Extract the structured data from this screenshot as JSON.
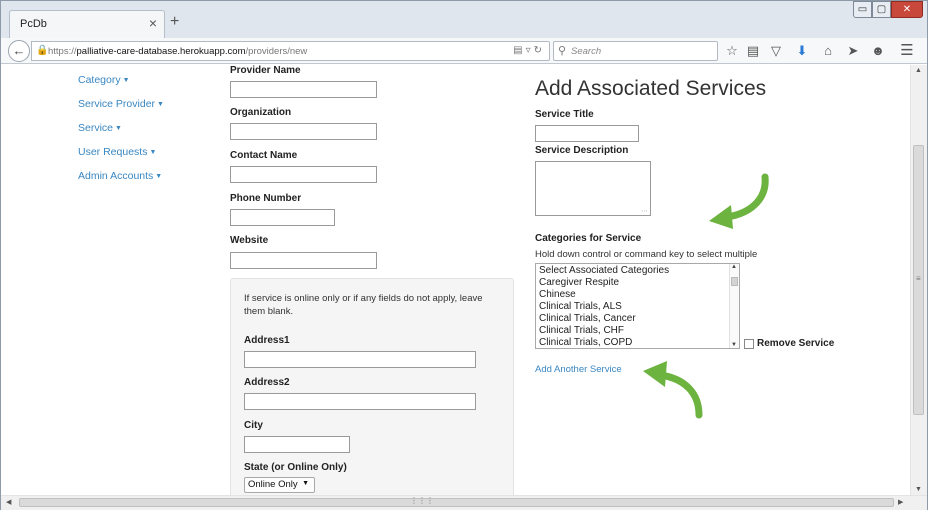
{
  "browser": {
    "tab_title": "PcDb",
    "tab_close": "×",
    "new_tab": "+",
    "url_prefix": "https://",
    "url_host": "palliative-care-database.herokuapp.com",
    "url_path": "/providers/new",
    "search_placeholder": "Search",
    "window_controls": {
      "minimize": "▭",
      "maximize": "▢",
      "close": "✕"
    },
    "toolbar_icons": [
      "star-icon",
      "reading-list-icon",
      "pocket-icon",
      "download-icon",
      "home-icon",
      "send-icon",
      "chat-icon",
      "menu-icon"
    ]
  },
  "sidebar": {
    "items": [
      {
        "label": "Category"
      },
      {
        "label": "Service Provider"
      },
      {
        "label": "Service"
      },
      {
        "label": "User Requests"
      },
      {
        "label": "Admin Accounts"
      }
    ]
  },
  "provider_form": {
    "provider_name_label": "Provider Name",
    "organization_label": "Organization",
    "contact_name_label": "Contact Name",
    "phone_number_label": "Phone Number",
    "website_label": "Website",
    "well_note": "If service is online only or if any fields do not apply, leave them blank.",
    "address1_label": "Address1",
    "address2_label": "Address2",
    "city_label": "City",
    "state_label": "State (or Online Only)",
    "state_value": "Online Only"
  },
  "services": {
    "heading": "Add Associated Services",
    "service_title_label": "Service Title",
    "service_description_label": "Service Description",
    "categories_label": "Categories for Service",
    "categories_help": "Hold down control or command key to select multiple",
    "category_options": [
      "Select Associated Categories",
      "Caregiver Respite",
      "Chinese",
      "Clinical Trials, ALS",
      "Clinical Trials, Cancer",
      "Clinical Trials, CHF",
      "Clinical Trials, COPD"
    ],
    "remove_service_label": "Remove Service",
    "add_another_label": "Add Another Service"
  },
  "colors": {
    "link": "#3a87c2",
    "annotation_arrow": "#6db33f"
  }
}
